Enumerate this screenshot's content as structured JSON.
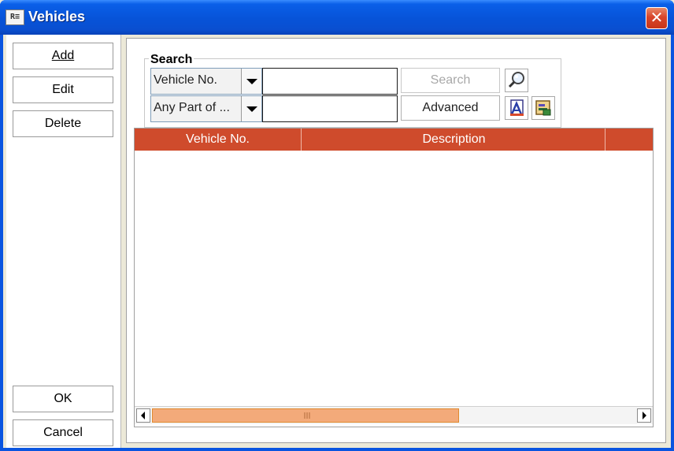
{
  "window": {
    "title": "Vehicles",
    "app_icon_text": "R≡"
  },
  "sidebar": {
    "add_label": "Add",
    "edit_label": "Edit",
    "delete_label": "Delete",
    "ok_label": "OK",
    "cancel_label": "Cancel"
  },
  "search": {
    "group_title": "Search",
    "field_combo": {
      "selected": "Vehicle No."
    },
    "match_combo": {
      "selected": "Any Part of ..."
    },
    "value_1": "",
    "value_2": "",
    "search_button": "Search",
    "advanced_button": "Advanced",
    "icons": [
      "magnifier-icon",
      "report-icon",
      "filter-icon"
    ]
  },
  "table": {
    "columns": [
      "Vehicle No.",
      "Description",
      ""
    ],
    "rows": [],
    "header_color": "#cf4b2c"
  },
  "colors": {
    "titlebar": "#0753d8",
    "accent": "#cf4b2c",
    "scroll_thumb": "#f3aa7a"
  }
}
